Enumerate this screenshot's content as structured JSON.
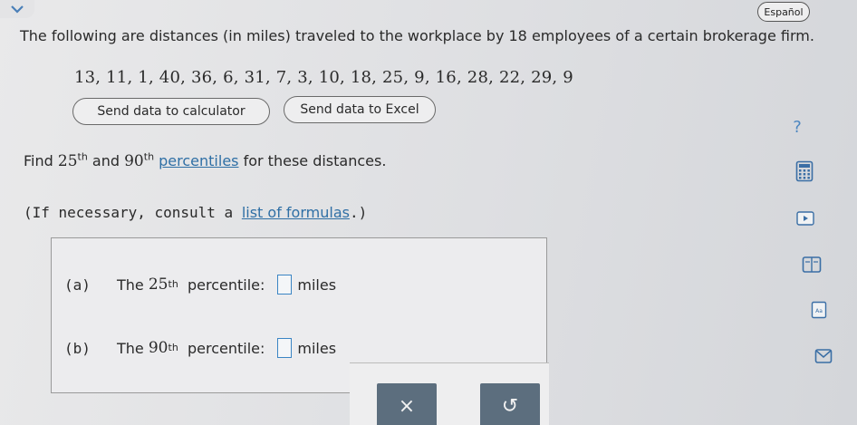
{
  "header": {
    "language_button": "Español"
  },
  "question": {
    "intro": "The following are distances (in miles) traveled to the workplace by 18 employees of a certain brokerage firm.",
    "data_values": "13, 11, 1, 40, 36, 6, 31, 7, 3, 10, 18, 25, 9, 16, 28, 22, 29, 9",
    "send_calculator_label": "Send data to calculator",
    "send_excel_label": "Send data to Excel",
    "find_prefix": "Find",
    "p1_num": "25",
    "p1_sup": "th",
    "and_text": "and",
    "p2_num": "90",
    "p2_sup": "th",
    "percentiles_link": "percentiles",
    "find_suffix": "for these distances.",
    "consult_prefix": "(If necessary, consult a",
    "formulas_link": "list of formulas",
    "consult_suffix": ".)"
  },
  "answers": {
    "a_tag": "(a)",
    "a_the": "The",
    "a_num": "25",
    "a_sup": "th",
    "a_label": "percentile:",
    "a_unit": "miles",
    "b_tag": "(b)",
    "b_the": "The",
    "b_num": "90",
    "b_sup": "th",
    "b_label": "percentile:",
    "b_unit": "miles"
  },
  "actions": {
    "clear_symbol": "×",
    "undo_symbol": "↺"
  },
  "sidebar": {
    "help_symbol": "?"
  }
}
